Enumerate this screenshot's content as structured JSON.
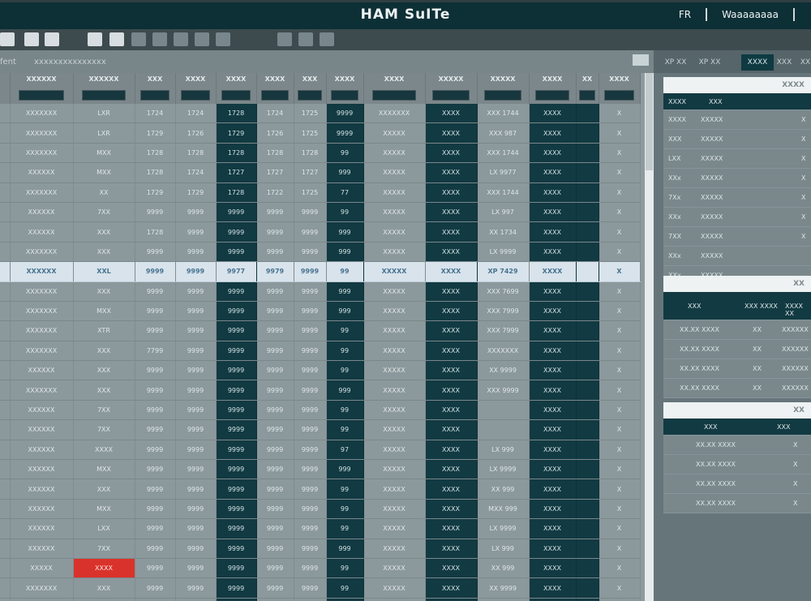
{
  "window": {
    "title": "HAM SuITe",
    "right_items": [
      "FR",
      "Waaaaaaaa"
    ]
  },
  "toolbar": {
    "icons": [
      "save-icon",
      "open-icon",
      "print-icon",
      "export-icon",
      "filter-icon",
      "refresh-icon",
      "nav-first-icon",
      "nav-prev-icon",
      "nav-next-icon",
      "nav-last-icon",
      "zoom-in-icon",
      "zoom-out-icon",
      "settings-icon"
    ]
  },
  "filterbar": {
    "label_left": "fent",
    "label_main": "xxxxxxxxxxxxxxx"
  },
  "grid": {
    "headers": [
      "",
      "XXXXXX",
      "XXXXXX",
      "XXX",
      "XXXX",
      "XXXX",
      "XXXX",
      "XXX",
      "XXXX",
      "XXXX",
      "XXXXX",
      "XXXXX",
      "XXXX",
      "XX",
      "XXXX"
    ],
    "rows": [
      [
        "",
        "XXXXXXX",
        "LXR",
        "1724",
        "1724",
        "1728",
        "1724",
        "1725",
        "9999",
        "XXXXXXX",
        "XXXX",
        "XXX 1744",
        "XXXX",
        "",
        "X"
      ],
      [
        "",
        "XXXXXXX",
        "LXR",
        "1729",
        "1726",
        "1729",
        "1726",
        "1725",
        "9999",
        "XXXXX",
        "XXXX",
        "XXX 987",
        "XXXX",
        "",
        "X"
      ],
      [
        "",
        "XXXXXXX",
        "MXX",
        "1728",
        "1728",
        "1728",
        "1728",
        "1728",
        "99",
        "XXXXX",
        "XXXX",
        "XXX 1744",
        "XXXX",
        "",
        "X"
      ],
      [
        "",
        "XXXXXX",
        "MXX",
        "1728",
        "1724",
        "1727",
        "1727",
        "1727",
        "999",
        "XXXXX",
        "XXXX",
        "LX 9977",
        "XXXX",
        "",
        "X"
      ],
      [
        "",
        "XXXXXXX",
        "XX",
        "1729",
        "1729",
        "1728",
        "1722",
        "1725",
        "77",
        "XXXXX",
        "XXXX",
        "XXX 1744",
        "XXXX",
        "",
        "X"
      ],
      [
        "",
        "XXXXXX",
        "7XX",
        "9999",
        "9999",
        "9999",
        "9999",
        "9999",
        "99",
        "XXXXX",
        "XXXX",
        "LX 997",
        "XXXX",
        "",
        "X"
      ],
      [
        "",
        "XXXXXX",
        "XXX",
        "1728",
        "9999",
        "9999",
        "9999",
        "9999",
        "999",
        "XXXXX",
        "XXXX",
        "XX 1734",
        "XXXX",
        "",
        "X"
      ],
      [
        "",
        "XXXXXXX",
        "XXX",
        "9999",
        "9999",
        "9999",
        "9999",
        "9999",
        "999",
        "XXXXX",
        "XXXX",
        "LX 9999",
        "XXXX",
        "",
        "X"
      ],
      [
        "",
        "XXXXXX",
        "XXL",
        "9999",
        "9999",
        "9977",
        "9979",
        "9999",
        "99",
        "XXXXX",
        "XXXX",
        "XP 7429",
        "XXXX",
        "",
        "X"
      ],
      [
        "",
        "XXXXXXX",
        "XXX",
        "9999",
        "9999",
        "9999",
        "9999",
        "9999",
        "999",
        "XXXXX",
        "XXXX",
        "XXX 7699",
        "XXXX",
        "",
        "X"
      ],
      [
        "",
        "XXXXXXX",
        "MXX",
        "9999",
        "9999",
        "9999",
        "9999",
        "9999",
        "999",
        "XXXXX",
        "XXXX",
        "XXX 7999",
        "XXXX",
        "",
        "X"
      ],
      [
        "",
        "XXXXXXX",
        "XTR",
        "9999",
        "9999",
        "9999",
        "9999",
        "9999",
        "99",
        "XXXXX",
        "XXXX",
        "XXX 7999",
        "XXXX",
        "",
        "X"
      ],
      [
        "",
        "XXXXXXX",
        "XXX",
        "7799",
        "9999",
        "9999",
        "9999",
        "9999",
        "99",
        "XXXXX",
        "XXXX",
        "XXXXXXX",
        "XXXX",
        "",
        "X"
      ],
      [
        "",
        "XXXXXX",
        "XXX",
        "9999",
        "9999",
        "9999",
        "9999",
        "9999",
        "99",
        "XXXXX",
        "XXXX",
        "XX 9999",
        "XXXX",
        "",
        "X"
      ],
      [
        "",
        "XXXXXXX",
        "XXX",
        "9999",
        "9999",
        "9999",
        "9999",
        "9999",
        "999",
        "XXXXX",
        "XXXX",
        "XXX 9999",
        "XXXX",
        "",
        "X"
      ],
      [
        "",
        "XXXXXX",
        "7XX",
        "9999",
        "9999",
        "9999",
        "9999",
        "9999",
        "99",
        "XXXXX",
        "XXXX",
        "",
        "XXXX",
        "",
        "X"
      ],
      [
        "",
        "XXXXXX",
        "7XX",
        "9999",
        "9999",
        "9999",
        "9999",
        "9999",
        "99",
        "XXXXX",
        "XXXX",
        "",
        "XXXX",
        "",
        "X"
      ],
      [
        "",
        "XXXXXX",
        "XXXX",
        "9999",
        "9999",
        "9999",
        "9999",
        "9999",
        "97",
        "XXXXX",
        "XXXX",
        "LX 999",
        "XXXX",
        "",
        "X"
      ],
      [
        "",
        "XXXXXX",
        "MXX",
        "9999",
        "9999",
        "9999",
        "9999",
        "9999",
        "999",
        "XXXXX",
        "XXXX",
        "LX 9999",
        "XXXX",
        "",
        "X"
      ],
      [
        "",
        "XXXXXX",
        "XXX",
        "9999",
        "9999",
        "9999",
        "9999",
        "9999",
        "99",
        "XXXXX",
        "XXXX",
        "XX 999",
        "XXXX",
        "",
        "X"
      ],
      [
        "",
        "XXXXXX",
        "MXX",
        "9999",
        "9999",
        "9999",
        "9999",
        "9999",
        "99",
        "XXXXX",
        "XXXX",
        "MXX 999",
        "XXXX",
        "",
        "X"
      ],
      [
        "",
        "XXXXXX",
        "LXX",
        "9999",
        "9999",
        "9999",
        "9999",
        "9999",
        "99",
        "XXXXX",
        "XXXX",
        "LX 9999",
        "XXXX",
        "",
        "X"
      ],
      [
        "",
        "XXXXXX",
        "7XX",
        "9999",
        "9999",
        "9999",
        "9999",
        "9999",
        "999",
        "XXXXX",
        "XXXX",
        "LX 999",
        "XXXX",
        "",
        "X"
      ],
      [
        "",
        "XXXXX",
        "XXXX",
        "9999",
        "9999",
        "9999",
        "9999",
        "9999",
        "99",
        "XXXXX",
        "XXXX",
        "XX 999",
        "XXXX",
        "",
        "X"
      ],
      [
        "",
        "XXXXXXX",
        "XXX",
        "9999",
        "9999",
        "9999",
        "9999",
        "9999",
        "99",
        "XXXXX",
        "XXXX",
        "XX 9999",
        "XXXX",
        "",
        "X"
      ],
      [
        "",
        "XXXXXXX",
        "MXX",
        "9999",
        "9999",
        "9999",
        "9999",
        "9999",
        "99",
        "XXXXX",
        "XXXX",
        "LX 9999",
        "XXXX",
        "",
        "X"
      ]
    ],
    "selected_row_index": 8,
    "alert_cell": {
      "row": 23,
      "col": 2
    },
    "colors": {
      "dark_col": "#123a42",
      "light_cell": "#8b989c",
      "selection": "#d8e3ec",
      "alert": "#d9322b"
    }
  },
  "right_panel": {
    "tabs": [
      "XP XX",
      "XP XX",
      "XXXX",
      "XXX",
      "XX"
    ],
    "active_tab_index": 2,
    "sections": [
      {
        "title": "XXXX",
        "headers": [
          "XXXX",
          "XXX",
          ""
        ],
        "rows": [
          [
            "XXXX",
            "XXXXX",
            "X"
          ],
          [
            "XXX",
            "XXXXX",
            "X"
          ],
          [
            "LXX",
            "XXXXX",
            "X"
          ],
          [
            "XXx",
            "XXXXX",
            "X"
          ],
          [
            "7Xx",
            "XXXXX",
            "X"
          ],
          [
            "XXx",
            "XXXXX",
            "X"
          ],
          [
            "7XX",
            "XXXXX",
            "X"
          ],
          [
            "XXx",
            "XXXXX",
            ""
          ],
          [
            "XXx",
            "XXXXX",
            ""
          ]
        ]
      },
      {
        "title": "XX",
        "headers": [
          "XXX",
          "XXX XXXX",
          "XXXX XX"
        ],
        "rows": [
          [
            "XX.XX XXXX",
            "XX",
            "XXXXXX"
          ],
          [
            "XX.XX XXXX",
            "XX",
            "XXXXXX"
          ],
          [
            "XX.XX XXXX",
            "XX",
            "XXXXXX"
          ],
          [
            "XX.XX XXXX",
            "XX",
            "XXXXXX"
          ]
        ]
      },
      {
        "title": "XX",
        "headers": [
          "XXX",
          "XXX"
        ],
        "rows": [
          [
            "XX.XX XXXX",
            "X"
          ],
          [
            "XX.XX XXXX",
            "X"
          ],
          [
            "XX.XX XXXX",
            "X"
          ],
          [
            "XX.XX XXXX",
            "X"
          ]
        ]
      }
    ]
  }
}
